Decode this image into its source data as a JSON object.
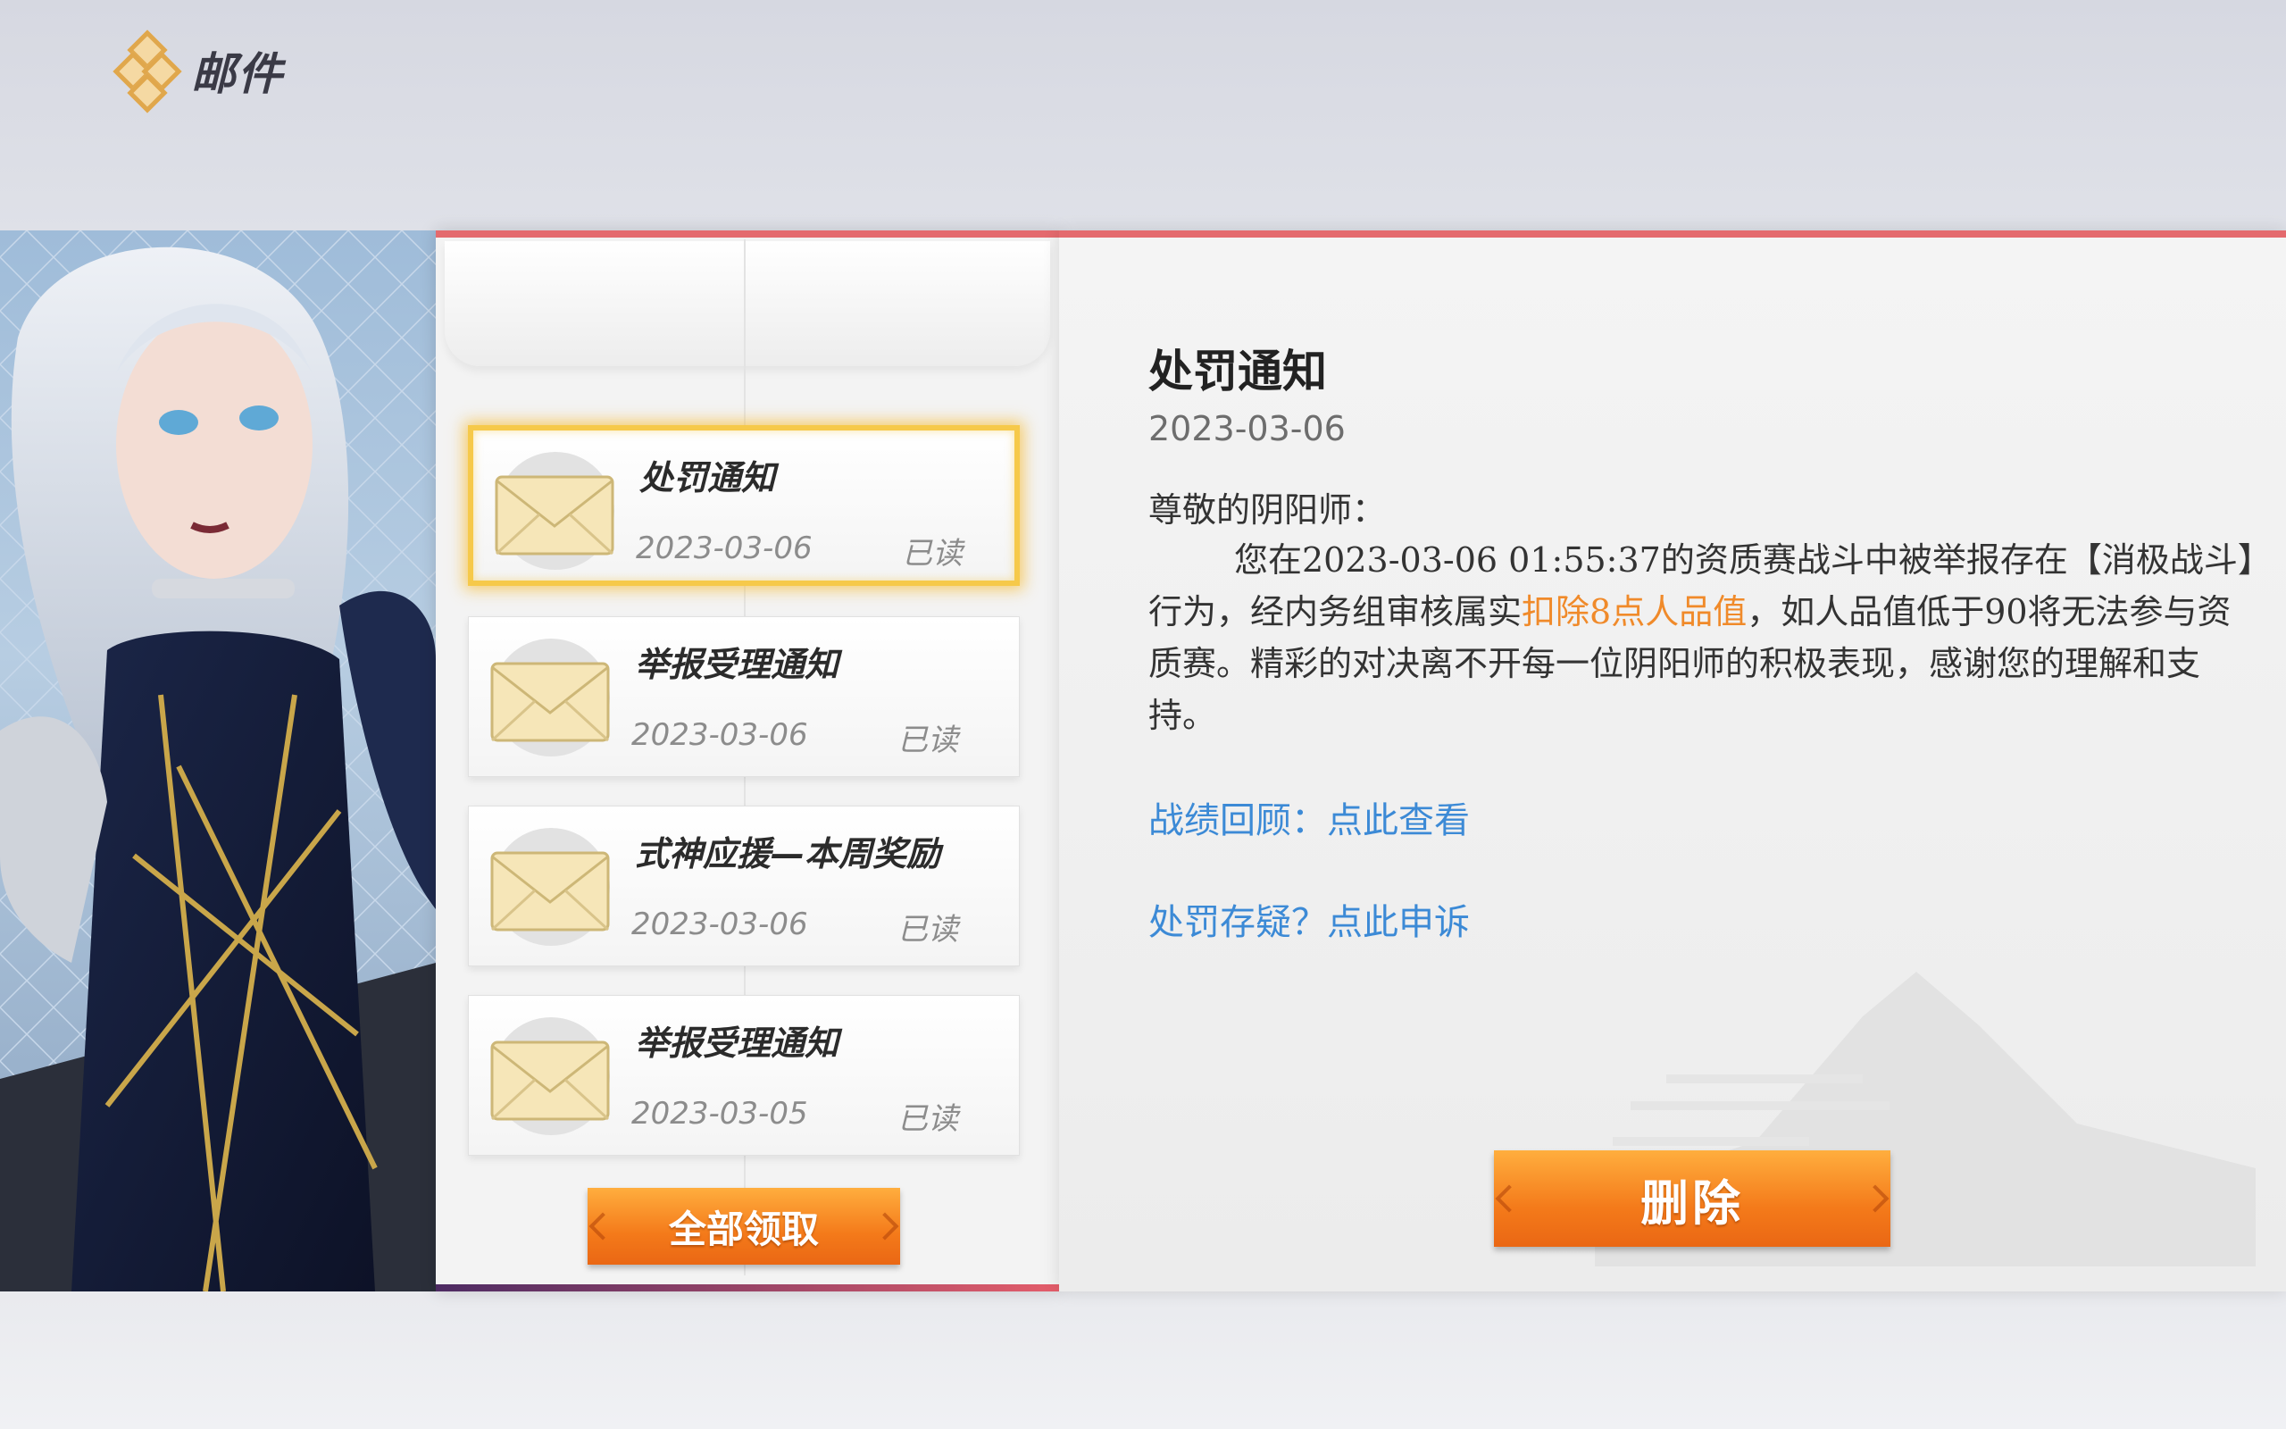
{
  "header": {
    "title": "邮件",
    "icon": "diamond-logo-icon"
  },
  "mail_list": [
    {
      "title": "处罚通知",
      "date": "2023-03-06",
      "status": "已读",
      "selected": true
    },
    {
      "title": "举报受理通知",
      "date": "2023-03-06",
      "status": "已读",
      "selected": false
    },
    {
      "title": "式神应援—本周奖励",
      "date": "2023-03-06",
      "status": "已读",
      "selected": false
    },
    {
      "title": "举报受理通知",
      "date": "2023-03-05",
      "status": "已读",
      "selected": false
    }
  ],
  "claim_all_label": "全部领取",
  "detail": {
    "title": "处罚通知",
    "date": "2023-03-06",
    "greeting": "尊敬的阴阳师：",
    "body_pre": "您在2023-03-06 01:55:37的资质赛战斗中被举报存在【消极战斗】行为，经内务组审核属实",
    "body_highlight": "扣除8点人品值",
    "body_post": "，如人品值低于90将无法参与资质赛。精彩的对决离不开每一位阴阳师的积极表现，感谢您的理解和支持。",
    "link1_prefix": "战绩回顾：",
    "link1_text": "点此查看",
    "link2_prefix": "处罚存疑？",
    "link2_text": "点此申诉"
  },
  "delete_label": "删除",
  "colors": {
    "accent_orange": "#f47a1a",
    "link_blue": "#3c8ad6",
    "highlight_orange": "#f08a2a",
    "panel_red": "#e46a6e"
  }
}
